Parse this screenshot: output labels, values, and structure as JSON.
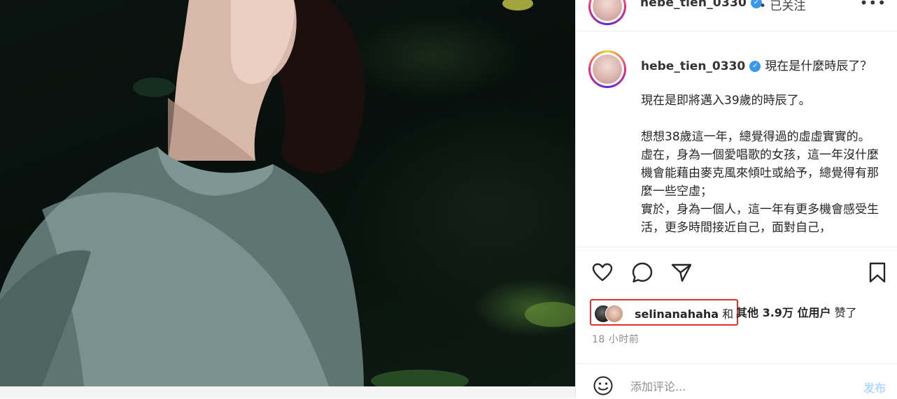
{
  "post": {
    "username": "hebe_tien_0330",
    "follow_status": "• 已关注",
    "caption_first_line": "現在是什麼時辰了？",
    "caption_body": "現在是即將邁入39歲的時辰了。\n\n想想38歲這一年，總覺得過的虛虛實實的。\n虛在，身為一個愛唱歌的女孩，這一年沒什麼機會能藉由麥克風來傾吐或給予，總覺得有那麼一些空虛；\n實於，身為一個人，這一年有更多機會感受生活，更多時間接近自己，面對自己，",
    "liked_by_user": "selinanahaha",
    "liked_by_and": " 和 ",
    "likes_others": "其他 3.9万 位用户",
    "likes_suffix": " 赞了",
    "timestamp": "18 小时前",
    "comment_placeholder": "添加评论...",
    "post_button": "发布"
  },
  "icons": {
    "more": "more-icon",
    "verified": "verified-badge-icon",
    "like": "heart-icon",
    "comment": "comment-icon",
    "share": "paper-plane-icon",
    "save": "bookmark-icon",
    "emoji": "emoji-icon"
  },
  "colors": {
    "verified": "#3897f0",
    "highlight_box": "#e3302c",
    "post_button": "#b3dbff"
  }
}
